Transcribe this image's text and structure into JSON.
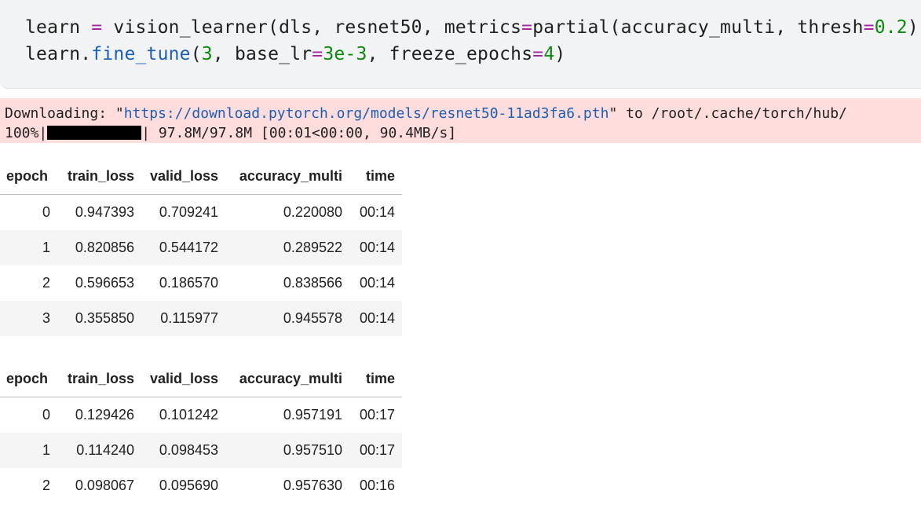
{
  "code": {
    "line1": [
      {
        "t": "learn ",
        "c": ""
      },
      {
        "t": "=",
        "c": "op"
      },
      {
        "t": " vision_learner(dls, resnet50, metrics",
        "c": ""
      },
      {
        "t": "=",
        "c": "op"
      },
      {
        "t": "partial(accuracy_multi, thresh",
        "c": ""
      },
      {
        "t": "=",
        "c": "op"
      },
      {
        "t": "0.2",
        "c": "num"
      },
      {
        "t": "))",
        "c": ""
      }
    ],
    "line2": [
      {
        "t": "learn.",
        "c": ""
      },
      {
        "t": "fine_tune",
        "c": "fn"
      },
      {
        "t": "(",
        "c": ""
      },
      {
        "t": "3",
        "c": "num"
      },
      {
        "t": ", base_lr",
        "c": ""
      },
      {
        "t": "=",
        "c": "op"
      },
      {
        "t": "3e-3",
        "c": "num"
      },
      {
        "t": ", freeze_epochs",
        "c": ""
      },
      {
        "t": "=",
        "c": "op"
      },
      {
        "t": "4",
        "c": "num"
      },
      {
        "t": ")",
        "c": ""
      }
    ]
  },
  "stderr": {
    "download_prefix": "Downloading: \"",
    "download_url": "https://download.pytorch.org/models/resnet50-11ad3fa6.pth",
    "download_suffix": "\" to /root/.cache/torch/hub/",
    "progress_percent_label": "100%|",
    "progress_fraction": 1.0,
    "progress_tail": "| 97.8M/97.8M [00:01<00:00, 90.4MB/s]"
  },
  "tables": [
    {
      "headers": [
        "epoch",
        "train_loss",
        "valid_loss",
        "accuracy_multi",
        "time"
      ],
      "rows": [
        [
          "0",
          "0.947393",
          "0.709241",
          "0.220080",
          "00:14"
        ],
        [
          "1",
          "0.820856",
          "0.544172",
          "0.289522",
          "00:14"
        ],
        [
          "2",
          "0.596653",
          "0.186570",
          "0.838566",
          "00:14"
        ],
        [
          "3",
          "0.355850",
          "0.115977",
          "0.945578",
          "00:14"
        ]
      ]
    },
    {
      "headers": [
        "epoch",
        "train_loss",
        "valid_loss",
        "accuracy_multi",
        "time"
      ],
      "rows": [
        [
          "0",
          "0.129426",
          "0.101242",
          "0.957191",
          "00:17"
        ],
        [
          "1",
          "0.114240",
          "0.098453",
          "0.957510",
          "00:17"
        ],
        [
          "2",
          "0.098067",
          "0.095690",
          "0.957630",
          "00:16"
        ]
      ]
    }
  ],
  "colors": {
    "code_bg": "#f2f3f4",
    "stderr_bg": "#ffdddd",
    "keyword_op": "#a626a4",
    "number": "#0a8a0a",
    "function": "#1a5fb4"
  }
}
